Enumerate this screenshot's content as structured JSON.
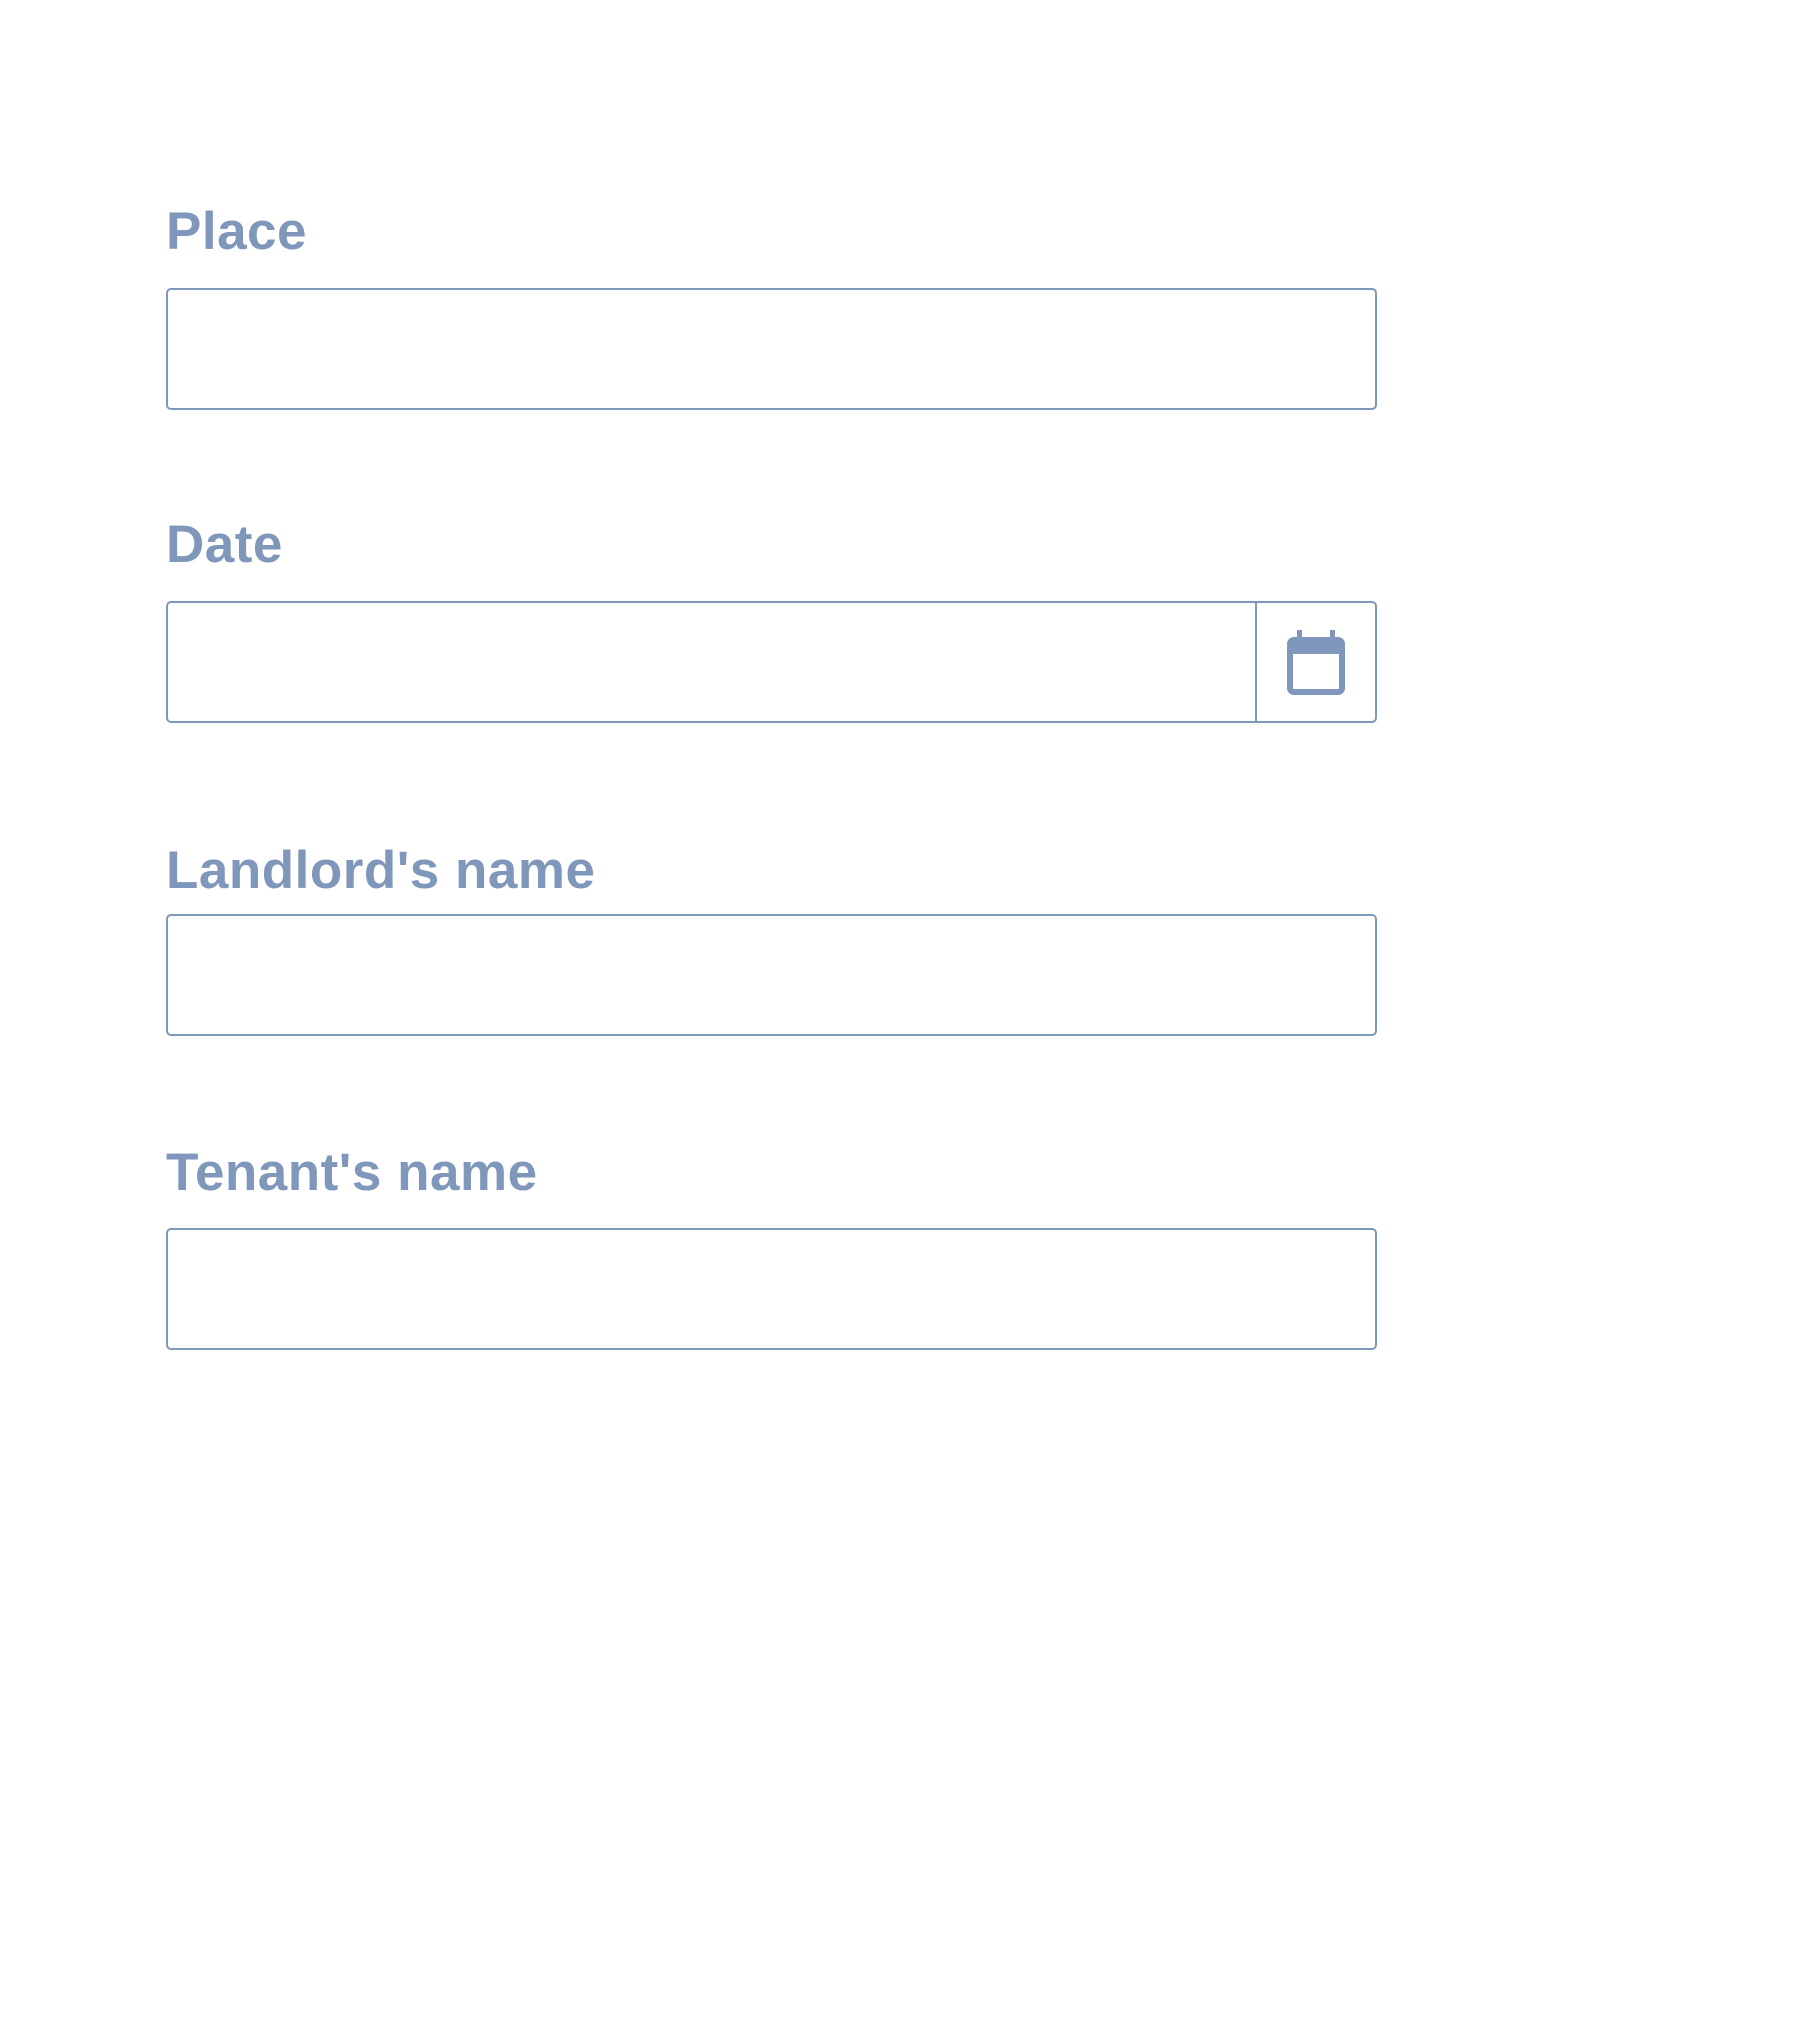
{
  "form": {
    "place": {
      "label": "Place",
      "value": ""
    },
    "date": {
      "label": "Date",
      "value": "",
      "button_icon": "calendar-icon"
    },
    "landlord": {
      "label": "Landlord's name",
      "value": ""
    },
    "tenant": {
      "label": "Tenant's name",
      "value": ""
    }
  },
  "colors": {
    "accent": "#7f97bb",
    "background": "#ffffff"
  }
}
